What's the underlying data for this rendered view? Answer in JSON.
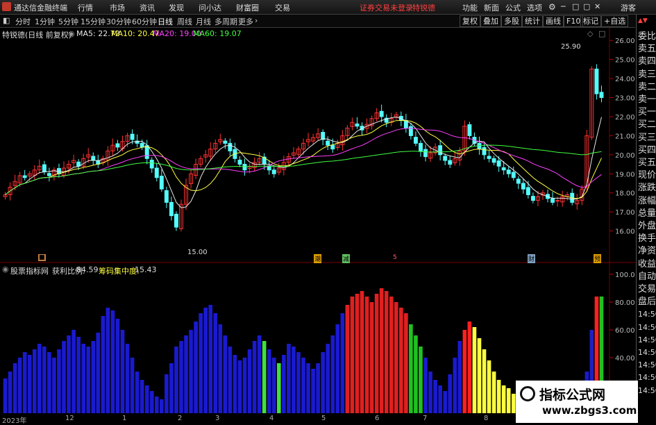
{
  "app": {
    "title": "通达信金融终端",
    "menu": [
      "行情",
      "市场",
      "资讯",
      "发现",
      "问小达",
      "财富圈",
      "交易"
    ],
    "warning": "证券交易未登录",
    "account": "特锐德",
    "right_menu": [
      "功能",
      "新面",
      "公式",
      "选项"
    ],
    "guest": "游客"
  },
  "toolbar": {
    "periods": [
      "分时",
      "1分钟",
      "5分钟",
      "15分钟",
      "30分钟",
      "60分钟",
      "日线",
      "周线",
      "月线",
      "多周期",
      "更多"
    ],
    "active_period": "日线",
    "right_buttons": [
      "复权",
      "叠加",
      "多股",
      "统计",
      "画线",
      "F10",
      "标记",
      "+自选"
    ]
  },
  "stock": {
    "name_label": "特锐德(日线 前复权)",
    "ma_labels": [
      "MA5: 22.72",
      "MA10: 20.47",
      "MA20: 19.00",
      "MA60: 19.07"
    ],
    "ma_colors": [
      "#e8e8e8",
      "#ffff40",
      "#ff40ff",
      "#40ff40"
    ],
    "high_label": "25.90",
    "low_label": "15.00",
    "event_markers": [
      "潮",
      "减",
      "5",
      "财",
      "预"
    ]
  },
  "price_axis": [
    "26.00",
    "25.00",
    "24.00",
    "23.00",
    "22.00",
    "21.00",
    "20.00",
    "19.00",
    "18.00",
    "17.00",
    "16.00"
  ],
  "indicator": {
    "name": "股票指标网",
    "profit_label": "获利比例:",
    "profit_value": "84.59",
    "conc_label": "筹码集中度:",
    "conc_value": "15.43"
  },
  "indicator_axis": [
    "100.0",
    "80.00",
    "60.00",
    "40.00"
  ],
  "date_axis": [
    "2023年",
    "12",
    "1",
    "2",
    "3",
    "4",
    "5",
    "6",
    "7",
    "8"
  ],
  "side_panel": [
    "委比",
    "卖五",
    "卖四",
    "卖三",
    "卖二",
    "卖一",
    "买一",
    "买二",
    "买三",
    "买四",
    "买五",
    "现价",
    "涨跌",
    "涨幅",
    "总量",
    "外盘",
    "换手",
    "净资",
    "收益",
    "自动",
    "交易",
    "盘后",
    "14:50",
    "14:50",
    "14:50",
    "14:50",
    "14:50",
    "14:50",
    "14:50"
  ],
  "watermark": {
    "line1": "指标公式网",
    "line2": "www.zbgs3.com"
  },
  "chart_data": {
    "type": "candlestick",
    "title": "特锐德(日线 前复权)",
    "ylim": [
      15,
      26.3
    ],
    "close_series": [
      17.9,
      18.3,
      18.6,
      18.9,
      18.8,
      19.0,
      19.2,
      19.4,
      19.1,
      18.9,
      19.2,
      19.0,
      19.3,
      19.5,
      19.7,
      19.4,
      19.8,
      20.0,
      19.7,
      19.5,
      19.8,
      20.2,
      20.5,
      20.4,
      20.7,
      21.0,
      20.8,
      20.6,
      20.4,
      19.8,
      19.3,
      18.8,
      18.2,
      17.5,
      16.8,
      16.2,
      17.4,
      18.4,
      19.0,
      19.5,
      19.8,
      20.0,
      20.3,
      20.6,
      20.8,
      20.6,
      20.2,
      19.8,
      19.5,
      19.2,
      19.4,
      19.6,
      19.8,
      19.5,
      19.2,
      19.0,
      19.3,
      19.6,
      19.9,
      20.1,
      20.3,
      20.6,
      20.8,
      20.9,
      21.1,
      20.8,
      20.5,
      20.3,
      20.6,
      21.0,
      21.4,
      21.7,
      21.5,
      21.3,
      21.6,
      21.9,
      22.2,
      22.0,
      21.7,
      21.9,
      22.1,
      21.8,
      21.4,
      21.0,
      20.6,
      20.2,
      19.9,
      20.1,
      20.4,
      20.0,
      19.7,
      19.5,
      19.8,
      20.2,
      21.5,
      21.0,
      20.6,
      20.3,
      20.0,
      19.8,
      19.6,
      19.4,
      19.2,
      19.0,
      18.8,
      18.5,
      18.2,
      17.9,
      17.6,
      17.8,
      18.0,
      17.7,
      17.5,
      17.6,
      17.8,
      17.9,
      17.5,
      17.6,
      18.2,
      21.0,
      24.5,
      23.2,
      23.0
    ],
    "indicator_values": [
      25,
      30,
      36,
      40,
      44,
      42,
      46,
      50,
      48,
      44,
      40,
      46,
      52,
      56,
      60,
      55,
      50,
      48,
      52,
      58,
      70,
      76,
      74,
      68,
      60,
      50,
      40,
      30,
      24,
      20,
      16,
      12,
      10,
      28,
      36,
      48,
      52,
      56,
      60,
      66,
      72,
      76,
      78,
      72,
      64,
      56,
      48,
      42,
      38,
      40,
      46,
      52,
      56,
      52,
      46,
      40,
      36,
      42,
      50,
      48,
      44,
      40,
      36,
      32,
      36,
      44,
      50,
      56,
      64,
      72,
      78,
      84,
      86,
      88,
      84,
      80,
      86,
      90,
      88,
      84,
      80,
      76,
      72,
      64,
      56,
      48,
      40,
      30,
      24,
      20,
      16,
      28,
      40,
      52,
      60,
      66,
      62,
      54,
      46,
      38,
      30,
      24,
      20,
      18,
      14,
      12,
      10,
      8,
      6,
      5,
      4,
      3,
      2,
      3,
      4,
      4,
      3,
      4,
      8,
      30,
      60,
      84,
      84
    ]
  }
}
